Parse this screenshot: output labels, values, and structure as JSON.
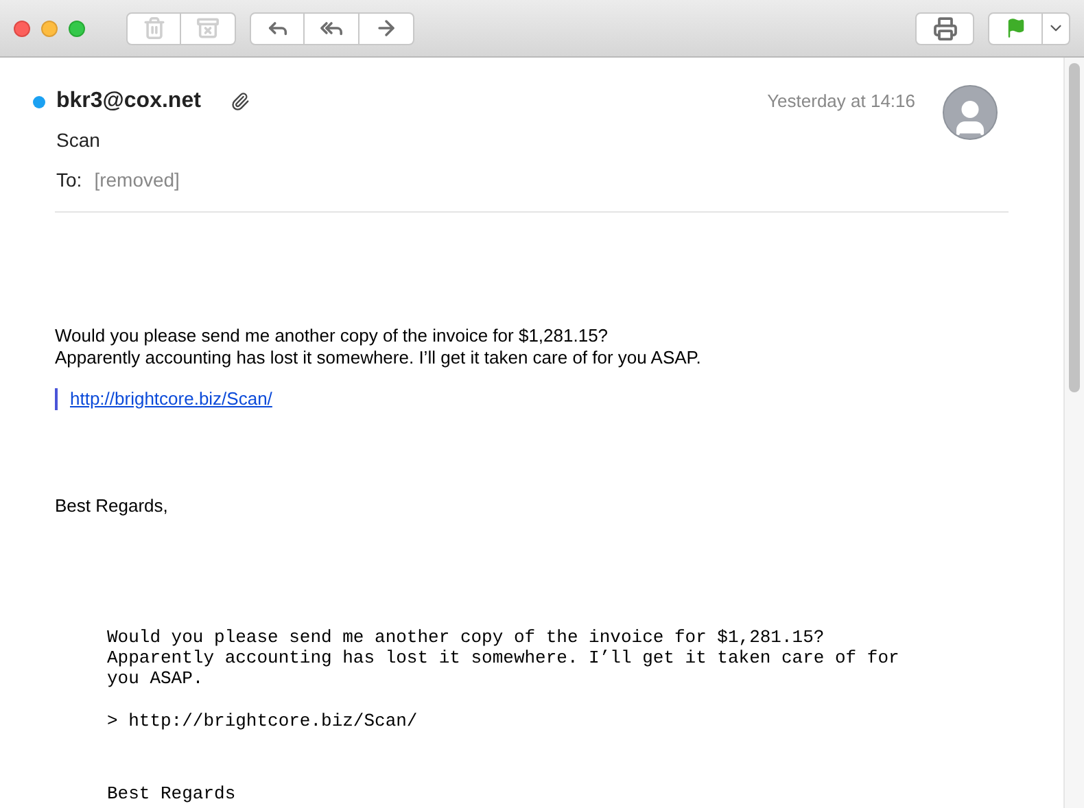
{
  "toolbar": {
    "groups": [
      [
        {
          "kind": "trash",
          "disabled": true
        },
        {
          "kind": "junk",
          "disabled": true
        }
      ],
      [
        {
          "kind": "reply",
          "disabled": false
        },
        {
          "kind": "reply_all",
          "disabled": false
        },
        {
          "kind": "forward",
          "disabled": false
        }
      ]
    ]
  },
  "message": {
    "unread": true,
    "sender": "bkr3@cox.net",
    "has_attachment": true,
    "date": "Yesterday at 14:16",
    "subject": "Scan",
    "to_label": "To:",
    "to_value": "[removed]",
    "body": {
      "lines": [
        "Would you please send me another copy of the invoice for $1,281.15?",
        "Apparently accounting has lost it somewhere. I’ll get it taken care of for you ASAP."
      ],
      "link": "http://brightcore.biz/Scan/",
      "closing": "Best Regards,"
    },
    "plain": {
      "lines": [
        "Would you please send me another copy of the invoice for $1,281.15?",
        "Apparently accounting has lost it somewhere. I’ll get it taken care of for",
        "you ASAP."
      ],
      "quote": "> http://brightcore.biz/Scan/",
      "closing": "Best Regards"
    }
  }
}
